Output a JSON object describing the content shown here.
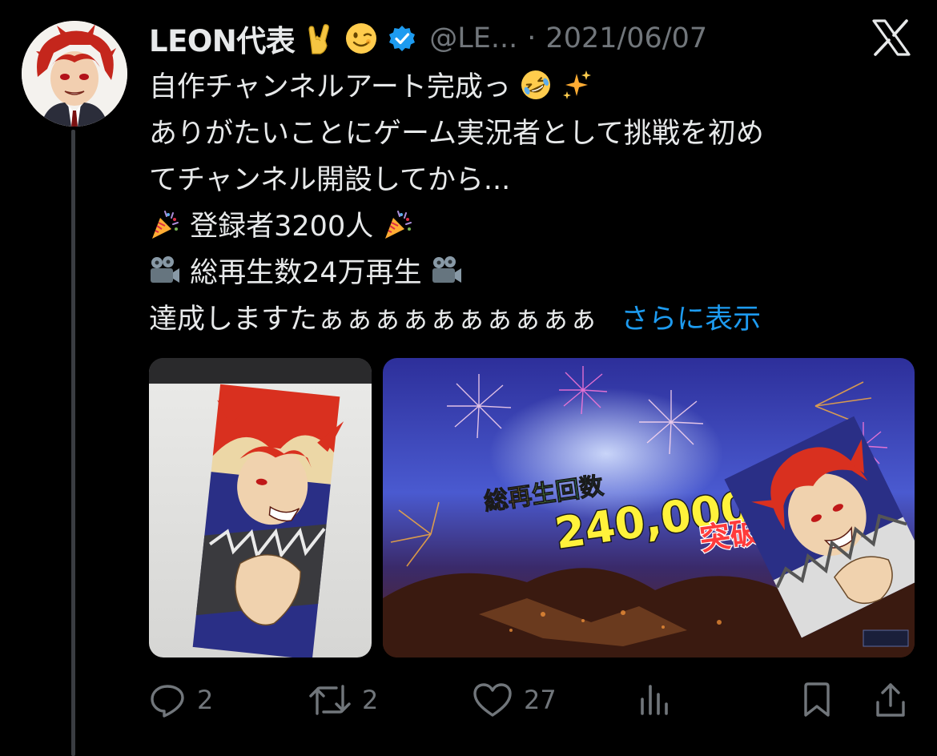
{
  "tweet": {
    "author": {
      "display_name": "LEON代表",
      "handle": "@LE...",
      "verified": true,
      "name_emojis": [
        "sign-of-horns-emoji",
        "winking-face-emoji"
      ]
    },
    "separator": "·",
    "date": "2021/06/07",
    "text_lines": [
      {
        "text": "自作チャンネルアート完成っ",
        "suffix": ""
      },
      {
        "text": "ありがたいことにゲーム実況者として挑戦を初め"
      },
      {
        "text": "てチャンネル開設してから..."
      },
      {
        "text": "登録者3200人"
      },
      {
        "text": "総再生数24万再生"
      },
      {
        "text": "達成しますたぁぁぁぁぁぁぁぁぁぁ"
      }
    ],
    "show_more": "さらに表示",
    "media": [
      {
        "name": "channel-art-drawing-photo"
      },
      {
        "name": "views-milestone-banner",
        "caption_small": "総再生回数",
        "caption_big": "240,000",
        "caption_suffix": "突破"
      }
    ],
    "actions": {
      "reply": {
        "icon": "reply-icon",
        "count": "2"
      },
      "retweet": {
        "icon": "retweet-icon",
        "count": "2"
      },
      "like": {
        "icon": "heart-icon",
        "count": "27"
      },
      "views": {
        "icon": "views-chart-icon"
      },
      "bookmark": {
        "icon": "bookmark-icon"
      },
      "share": {
        "icon": "share-icon"
      }
    }
  },
  "colors": {
    "background": "#000000",
    "text_primary": "#e7e9ea",
    "text_secondary": "#71767b",
    "link": "#1d9bf0",
    "verified": "#1d9bf0"
  }
}
